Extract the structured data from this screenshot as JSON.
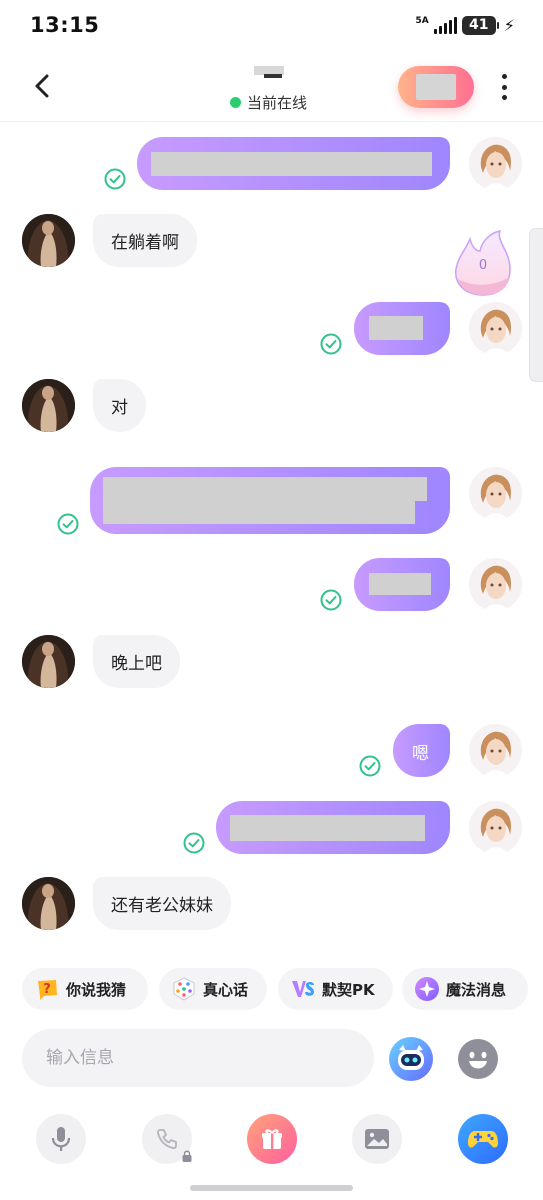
{
  "status_bar": {
    "time": "13:15",
    "network": "5A",
    "battery": "41"
  },
  "header": {
    "online_status": "当前在线",
    "online_color": "#2ecc71"
  },
  "messages": [
    {
      "side": "self",
      "text": "",
      "read": true
    },
    {
      "side": "other",
      "text": "在躺着啊"
    },
    {
      "side": "self",
      "text": "",
      "read": true
    },
    {
      "side": "other",
      "text": "对"
    },
    {
      "side": "self",
      "text": "",
      "read": true
    },
    {
      "side": "self",
      "text": "",
      "read": true
    },
    {
      "side": "other",
      "text": "晚上吧"
    },
    {
      "side": "self",
      "text": "嗯",
      "read": true
    },
    {
      "side": "self",
      "text": "",
      "read": true
    },
    {
      "side": "other",
      "text": "还有老公妹妹"
    }
  ],
  "intimacy_badge": {
    "value": "0",
    "icon": "flame-icon"
  },
  "quick_actions": [
    {
      "label": "你说我猜",
      "icon": "question-card-icon"
    },
    {
      "label": "真心话",
      "icon": "dice-icon"
    },
    {
      "label": "默契PK",
      "icon": "vs-icon"
    },
    {
      "label": "魔法消息",
      "icon": "magic-star-icon"
    }
  ],
  "composer": {
    "placeholder": "输入信息",
    "value": ""
  },
  "toolbar": [
    {
      "name": "voice",
      "icon": "microphone-icon"
    },
    {
      "name": "call",
      "icon": "phone-icon",
      "locked": true
    },
    {
      "name": "gift",
      "icon": "gift-icon"
    },
    {
      "name": "image",
      "icon": "image-icon"
    },
    {
      "name": "game",
      "icon": "gamepad-icon"
    }
  ],
  "colors": {
    "bubble_out_start": "#c79bff",
    "bubble_out_end": "#9f86ff",
    "bubble_in": "#f3f3f6",
    "read_check": "#2fc28c",
    "follow_gradient_start": "#ffb38a",
    "follow_gradient_end": "#ff6f91"
  }
}
